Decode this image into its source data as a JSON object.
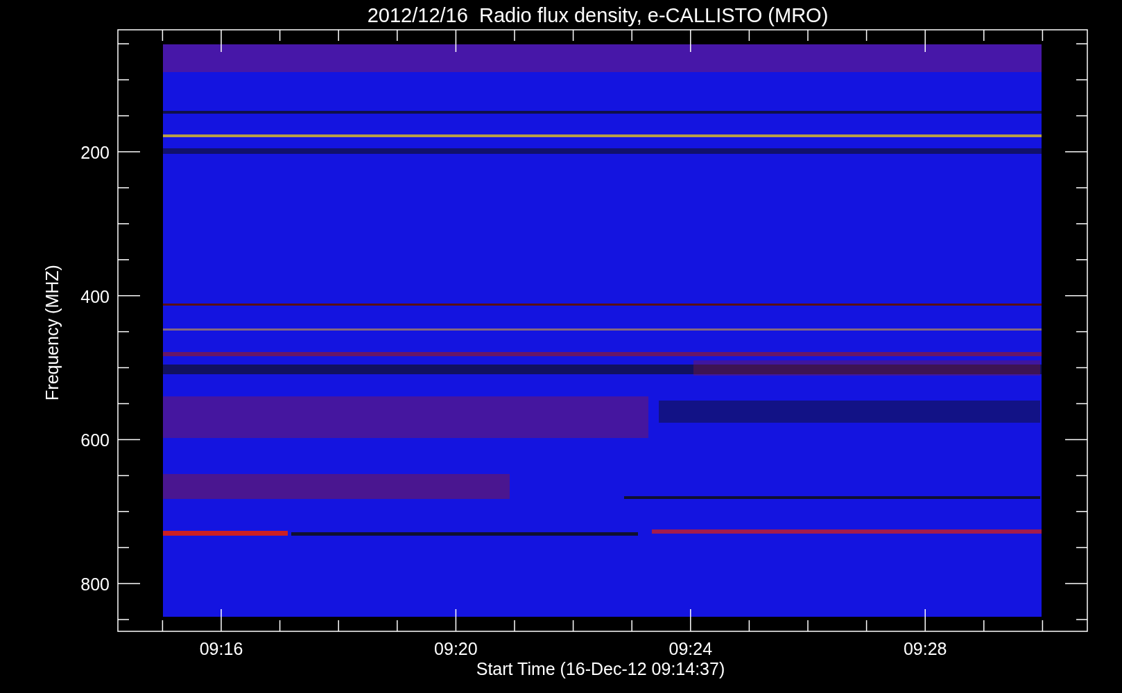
{
  "title": "2012/12/16  Radio flux density, e-CALLISTO (MRO)",
  "ylabel": "Frequency (MHZ)",
  "xlabel": "Start Time (16-Dec-12 09:14:37)",
  "yticks": [
    "200",
    "400",
    "600",
    "800"
  ],
  "xticks": [
    "09:16",
    "09:20",
    "09:24",
    "09:28"
  ]
}
